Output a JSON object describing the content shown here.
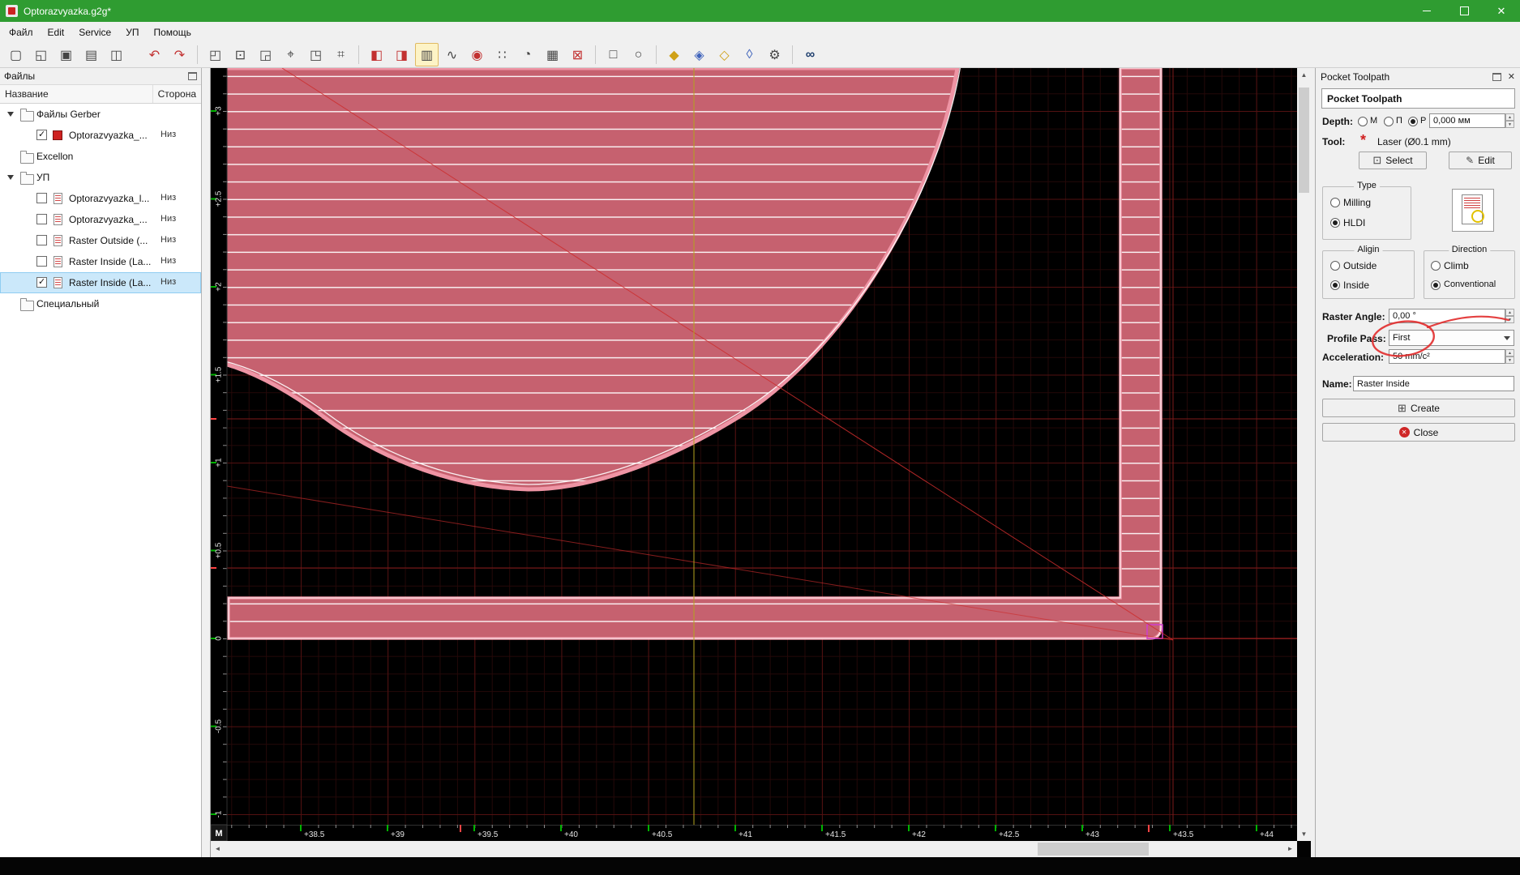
{
  "window": {
    "title": "Optorazvyazka.g2g*"
  },
  "menu": {
    "items": [
      "Файл",
      "Edit",
      "Service",
      "УП",
      "Помощь"
    ]
  },
  "toolbar": {
    "icons": [
      {
        "name": "new-file",
        "glyph": "▢"
      },
      {
        "name": "open-file",
        "glyph": "◱"
      },
      {
        "name": "save-file",
        "glyph": "▣"
      },
      {
        "name": "save-all",
        "glyph": "▤"
      },
      {
        "name": "export-gcode",
        "glyph": "◫"
      },
      {
        "name": "undo-red",
        "glyph": "↶"
      },
      {
        "name": "redo-red",
        "glyph": "↷"
      },
      {
        "name": "select-region",
        "glyph": "◰"
      },
      {
        "name": "select-all",
        "glyph": "⊡"
      },
      {
        "name": "deselect",
        "glyph": "◲"
      },
      {
        "name": "move-tool",
        "glyph": "⌖"
      },
      {
        "name": "transform-tool",
        "glyph": "◳"
      },
      {
        "name": "snap-grid",
        "glyph": "⌗"
      },
      {
        "name": "mirror-horizontal",
        "glyph": "◧"
      },
      {
        "name": "mirror-vertical",
        "glyph": "◨"
      },
      {
        "name": "raster-view",
        "glyph": "▥"
      },
      {
        "name": "curve-tool",
        "glyph": "∿"
      },
      {
        "name": "laser-spot",
        "glyph": "◉"
      },
      {
        "name": "dot-grid",
        "glyph": "∷"
      },
      {
        "name": "simulate",
        "glyph": "◔"
      },
      {
        "name": "table-view",
        "glyph": "▦"
      },
      {
        "name": "fixture-marks",
        "glyph": "⊠"
      },
      {
        "name": "draw-rectangle",
        "glyph": "□"
      },
      {
        "name": "draw-ellipse",
        "glyph": "○"
      },
      {
        "name": "poly-union",
        "glyph": "◆"
      },
      {
        "name": "poly-subtract",
        "glyph": "◈"
      },
      {
        "name": "poly-intersect",
        "glyph": "◇"
      },
      {
        "name": "poly-offset",
        "glyph": "◊"
      },
      {
        "name": "settings",
        "glyph": "⚙"
      },
      {
        "name": "find",
        "glyph": "∞"
      }
    ]
  },
  "files": {
    "title": "Файлы",
    "columns": [
      "Название",
      "Сторона"
    ],
    "rows": [
      {
        "name": "Файлы Gerber",
        "side": ""
      },
      {
        "name": "Optorazvyazka_...",
        "side": "Низ"
      },
      {
        "name": "Excellon",
        "side": ""
      },
      {
        "name": "УП",
        "side": ""
      },
      {
        "name": "Optorazvyazka_l...",
        "side": "Низ"
      },
      {
        "name": "Optorazvyazka_...",
        "side": "Низ"
      },
      {
        "name": "Raster Outside (...",
        "side": "Низ"
      },
      {
        "name": "Raster Inside (La...",
        "side": "Низ"
      },
      {
        "name": "Raster Inside (La...",
        "side": "Низ"
      },
      {
        "name": "Специальный",
        "side": ""
      }
    ]
  },
  "canvas": {
    "corner_label": "M",
    "ruler_x": [
      "+38.5",
      "+39",
      "+39.5",
      "+40",
      "+40.5",
      "+41",
      "+41.5",
      "+42",
      "+42.5",
      "+43",
      "+43.5",
      "+44"
    ],
    "ruler_y": [
      "+3",
      "+2.5",
      "+2",
      "+1.5",
      "+1",
      "+0.5",
      "0",
      "-0.5",
      "-1"
    ],
    "colors": {
      "grid_minor": "#240808",
      "grid_major": "#521111",
      "pocket_fill": "#c6616f",
      "pocket_edge": "#ee94a4",
      "hatch": "#ffffff",
      "crosshair": "#b3a31e"
    }
  },
  "panel": {
    "header": "Pocket Toolpath",
    "title": "Pocket Toolpath",
    "depth_label": "Depth:",
    "depth_options": [
      "M",
      "П",
      "P"
    ],
    "depth_value": "0,000 мм",
    "tool_label": "Tool:",
    "tool_value": "Laser (Ø0.1 mm)",
    "select_button": "Select",
    "edit_button": "Edit",
    "type_group": "Type",
    "type_options": [
      "Milling",
      "HLDI"
    ],
    "align_group": "Aligin",
    "align_options": [
      "Outside",
      "Inside"
    ],
    "direction_group": "Direction",
    "direction_options": [
      "Climb",
      "Conventional"
    ],
    "raster_angle_label": "Raster Angle:",
    "raster_angle_value": "0,00 °",
    "profile_pass_label": "Profile Pass:",
    "profile_pass_value": "First",
    "acceleration_label": "Acceleration:",
    "acceleration_value": "50 mm/c²",
    "name_label": "Name:",
    "name_value": "Raster Inside",
    "create_button": "Create",
    "close_button": "Close",
    "annotation_color": "#e12b2b"
  }
}
